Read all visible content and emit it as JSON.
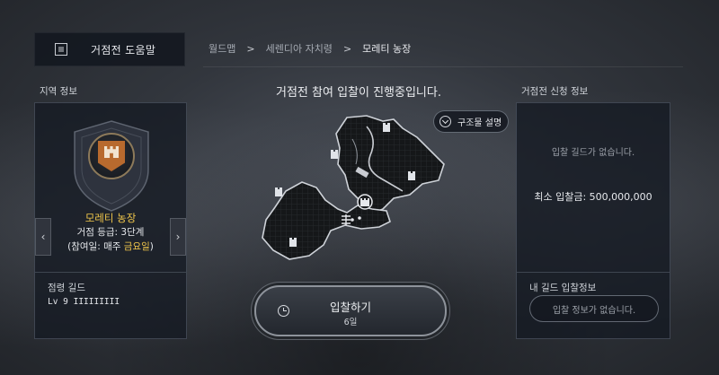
{
  "help": {
    "label": "거점전 도움말",
    "icon": "help-book-icon"
  },
  "breadcrumb": {
    "items": [
      "월드맵",
      "세렌디아 자치령",
      "모레티 농장"
    ],
    "separator": ">"
  },
  "left_panel": {
    "title": "지역 정보",
    "region_name": "모레티 농장",
    "grade": "거점 등급: 3단계",
    "day_prefix": "(참여일: 매주 ",
    "day_value": "금요일",
    "day_suffix": ")",
    "prev_arrow": "‹",
    "next_arrow": "›",
    "occupying_title": "점령 길드",
    "occupying_guild": "Lv 9 IIIIIIIII"
  },
  "center": {
    "title": "거점전 참여 입찰이 진행중입니다.",
    "structure_button": "구조물 설명",
    "bid_button": {
      "label": "입찰하기",
      "sub": "6일"
    }
  },
  "right_panel": {
    "title": "거점전 신청 정보",
    "no_guild": "입찰 길드가 없습니다.",
    "min_bid": "최소 입찰금: 500,000,000",
    "my_title": "내 길드 입찰정보",
    "my_status": "입찰 정보가 없습니다."
  },
  "colors": {
    "accent_gold": "#f0c64b",
    "emblem_orange": "#b86a2e"
  }
}
